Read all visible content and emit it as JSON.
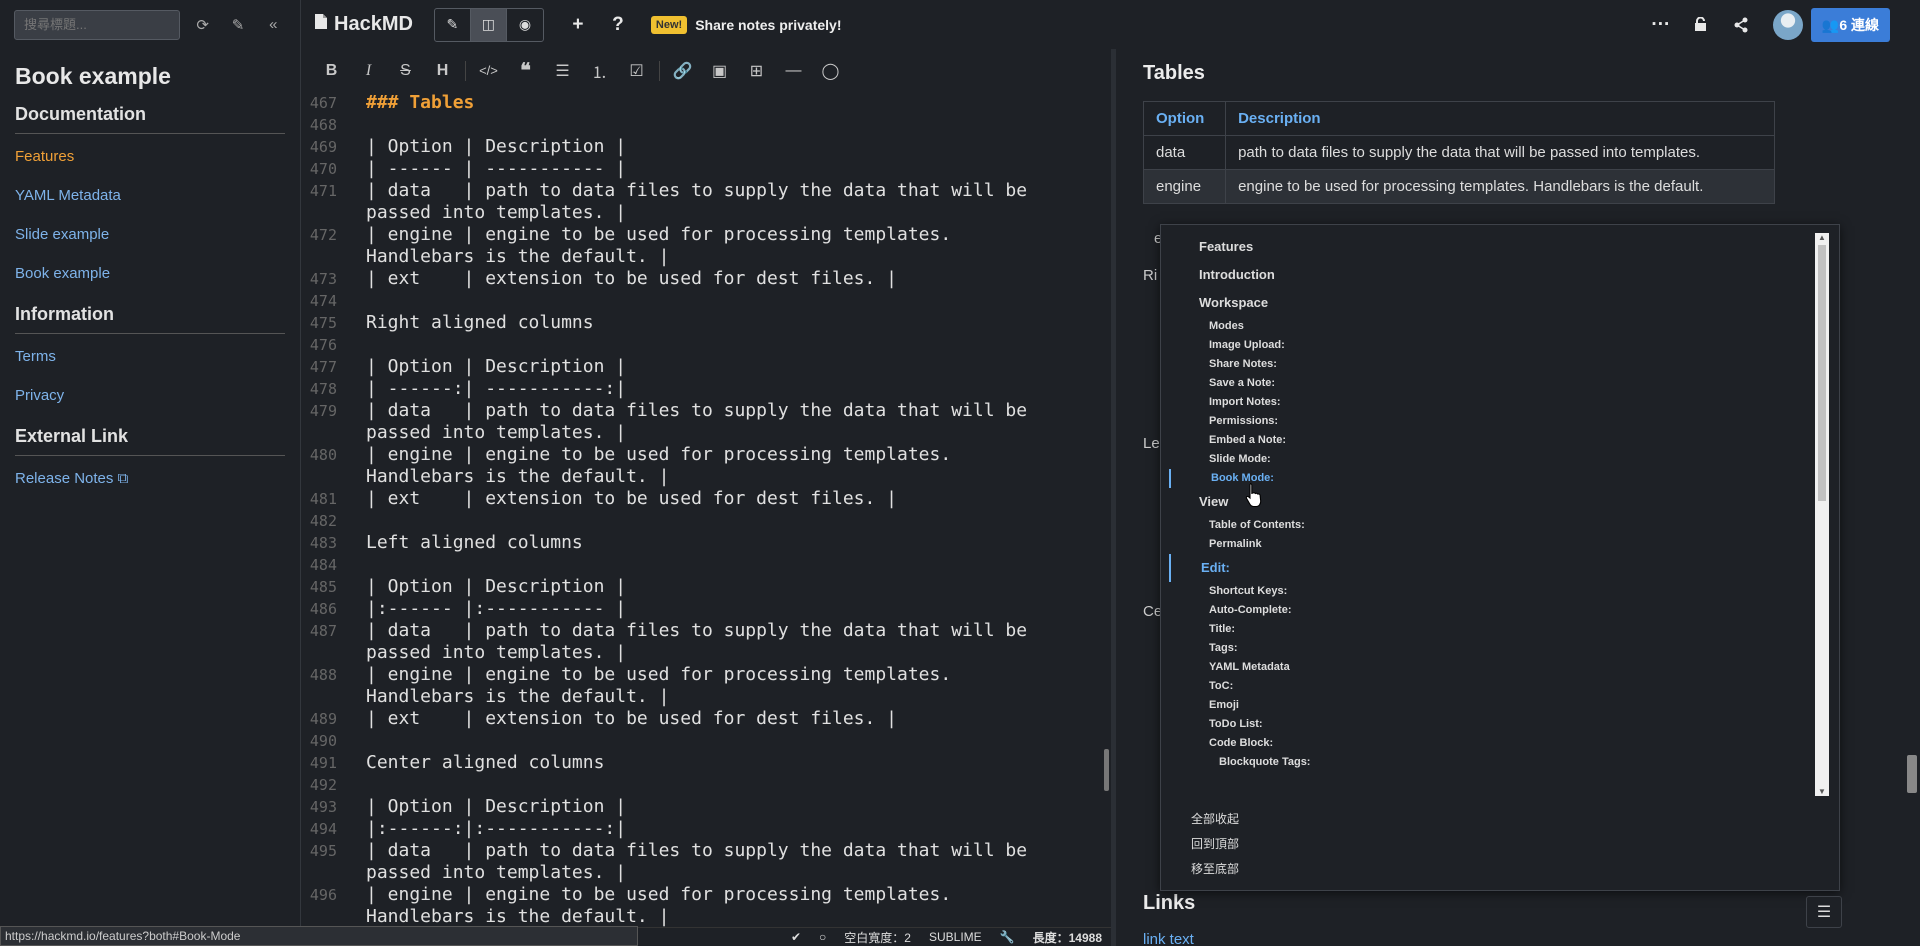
{
  "sidebar": {
    "search_placeholder": "搜尋標題...",
    "book_title": "Book example",
    "sections": [
      {
        "heading": "Documentation",
        "links": [
          "Features",
          "YAML Metadata",
          "Slide example",
          "Book example"
        ]
      },
      {
        "heading": "Information",
        "links": [
          "Terms",
          "Privacy"
        ]
      },
      {
        "heading": "External Link",
        "links": [
          "Release Notes"
        ]
      }
    ]
  },
  "topbar": {
    "brand": "HackMD",
    "new_badge": "New!",
    "share_text": "Share notes privately!",
    "online_button": "6 連線"
  },
  "editor": {
    "lines": [
      {
        "n": "467",
        "t": "### Tables",
        "h": true
      },
      {
        "n": "468",
        "t": ""
      },
      {
        "n": "469",
        "t": "| Option | Description |"
      },
      {
        "n": "470",
        "t": "| ------ | ----------- |"
      },
      {
        "n": "471",
        "t": "| data   | path to data files to supply the data that will be"
      },
      {
        "n": "",
        "t": "passed into templates. |"
      },
      {
        "n": "472",
        "t": "| engine | engine to be used for processing templates."
      },
      {
        "n": "",
        "t": "Handlebars is the default. |"
      },
      {
        "n": "473",
        "t": "| ext    | extension to be used for dest files. |"
      },
      {
        "n": "474",
        "t": ""
      },
      {
        "n": "475",
        "t": "Right aligned columns"
      },
      {
        "n": "476",
        "t": ""
      },
      {
        "n": "477",
        "t": "| Option | Description |"
      },
      {
        "n": "478",
        "t": "| ------:| -----------:|"
      },
      {
        "n": "479",
        "t": "| data   | path to data files to supply the data that will be"
      },
      {
        "n": "",
        "t": "passed into templates. |"
      },
      {
        "n": "480",
        "t": "| engine | engine to be used for processing templates."
      },
      {
        "n": "",
        "t": "Handlebars is the default. |"
      },
      {
        "n": "481",
        "t": "| ext    | extension to be used for dest files. |"
      },
      {
        "n": "482",
        "t": ""
      },
      {
        "n": "483",
        "t": "Left aligned columns"
      },
      {
        "n": "484",
        "t": ""
      },
      {
        "n": "485",
        "t": "| Option | Description |"
      },
      {
        "n": "486",
        "t": "|:------ |:----------- |"
      },
      {
        "n": "487",
        "t": "| data   | path to data files to supply the data that will be"
      },
      {
        "n": "",
        "t": "passed into templates. |"
      },
      {
        "n": "488",
        "t": "| engine | engine to be used for processing templates."
      },
      {
        "n": "",
        "t": "Handlebars is the default. |"
      },
      {
        "n": "489",
        "t": "| ext    | extension to be used for dest files. |"
      },
      {
        "n": "490",
        "t": ""
      },
      {
        "n": "491",
        "t": "Center aligned columns"
      },
      {
        "n": "492",
        "t": ""
      },
      {
        "n": "493",
        "t": "| Option | Description |"
      },
      {
        "n": "494",
        "t": "|:------:|:-----------:|"
      },
      {
        "n": "495",
        "t": "| data   | path to data files to supply the data that will be"
      },
      {
        "n": "",
        "t": "passed into templates. |"
      },
      {
        "n": "496",
        "t": "| engine | engine to be used for processing templates."
      },
      {
        "n": "",
        "t": "Handlebars is the default. |"
      }
    ]
  },
  "status": {
    "indent": "空白寬度：2",
    "keymap": "SUBLIME",
    "length": "長度：14988",
    "url_tip": "https://hackmd.io/features?both#Book-Mode"
  },
  "preview": {
    "heading": "Tables",
    "table": {
      "headers": [
        "Option",
        "Description"
      ],
      "rows": [
        [
          "data",
          "path to data files to supply the data that will be passed into templates."
        ],
        [
          "engine",
          "engine to be used for processing templates. Handlebars is the default."
        ]
      ]
    },
    "stub_e": "e",
    "stub_ri": "Ri",
    "stub_le": "Le",
    "stub_ce": "Ce",
    "links_heading": "Links",
    "link_text": "link text"
  },
  "toc": {
    "items": [
      {
        "label": "Features",
        "level": 1
      },
      {
        "label": "Introduction",
        "level": 1
      },
      {
        "label": "Workspace",
        "level": 1
      },
      {
        "label": "Modes",
        "level": 2
      },
      {
        "label": "Image Upload:",
        "level": 2
      },
      {
        "label": "Share Notes:",
        "level": 2
      },
      {
        "label": "Save a Note:",
        "level": 2
      },
      {
        "label": "Import Notes:",
        "level": 2
      },
      {
        "label": "Permissions:",
        "level": 2
      },
      {
        "label": "Embed a Note:",
        "level": 2
      },
      {
        "label": "Slide Mode:",
        "level": 2
      },
      {
        "label": "Book Mode:",
        "level": 2,
        "active": true
      },
      {
        "label": "View",
        "level": 1
      },
      {
        "label": "Table of Contents:",
        "level": 2
      },
      {
        "label": "Permalink",
        "level": 2
      },
      {
        "label": "Edit:",
        "level": 1,
        "active": true
      },
      {
        "label": "Shortcut Keys:",
        "level": 2
      },
      {
        "label": "Auto-Complete:",
        "level": 2
      },
      {
        "label": "Title:",
        "level": 2
      },
      {
        "label": "Tags:",
        "level": 2
      },
      {
        "label": "YAML Metadata",
        "level": 2
      },
      {
        "label": "ToC:",
        "level": 2
      },
      {
        "label": "Emoji",
        "level": 2
      },
      {
        "label": "ToDo List:",
        "level": 2
      },
      {
        "label": "Code Block:",
        "level": 2
      },
      {
        "label": "Blockquote Tags:",
        "level": 3
      }
    ],
    "actions": [
      "全部收起",
      "回到頂部",
      "移至底部"
    ]
  }
}
